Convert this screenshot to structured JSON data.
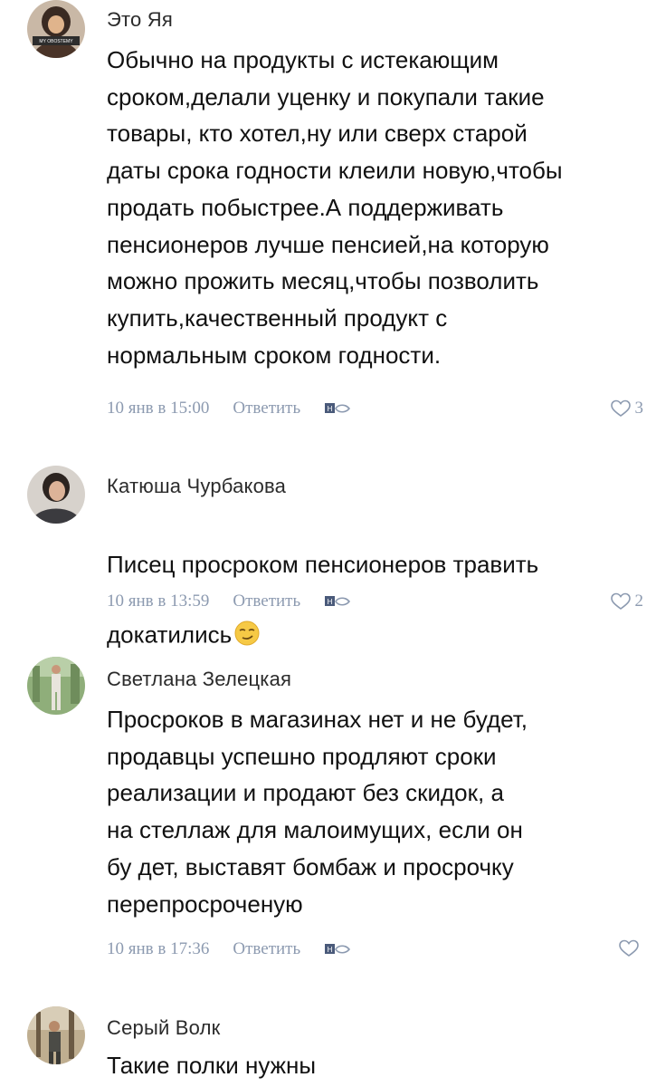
{
  "comments": [
    {
      "author": "Это Яя",
      "text": "Обычно на продукты с истекающим\nсроком,делали уценку и покупали такие\nтовары, кто хотел,ну или сверх старой\nдаты срока годности клеили новую,чтобы\nпродать побыстрее.А поддерживать\nпенсионеров лучше пенсией,на которую\nможно прожить месяц,чтобы позволить\nкупить,качественный продукт с\nнормальным сроком годности.",
      "time": "10 янв в 15:00",
      "reply": "Ответить",
      "likes": "3"
    },
    {
      "author": "Катюша Чурбакова",
      "text": "Писец просроком пенсионеров травить\nдокатились",
      "time": "10 янв в 13:59",
      "reply": "Ответить",
      "likes": "2"
    },
    {
      "author": "Светлана Зелецкая",
      "text": "Просроков в магазинах нет и не будет,\nпродавцы успешно продляют сроки\nреализации и продают без скидок, а\nна стеллаж  для малоимущих, если он\nбу дет, выставят бомбаж и просрочку\nперепросроченую",
      "time": "10 янв в 17:36",
      "reply": "Ответить",
      "likes": ""
    },
    {
      "author": "Серый Волк",
      "text": "Такие полки нужны"
    }
  ],
  "icons": {
    "like": "heart-icon",
    "share": "share-icon",
    "emoji": "smirk-emoji-icon"
  },
  "colors": {
    "meta": "#8c9ab0",
    "text": "#111111"
  }
}
